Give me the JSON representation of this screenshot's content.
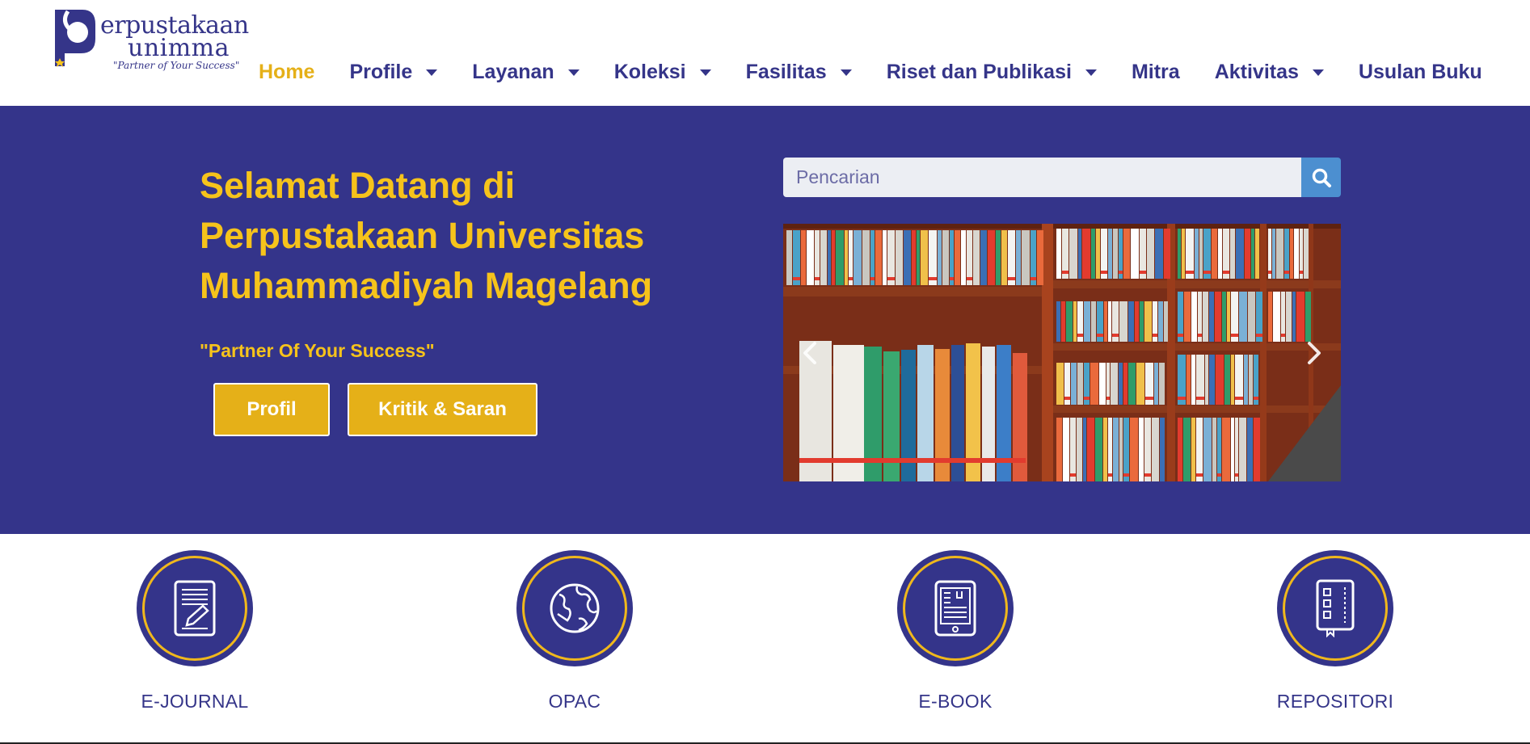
{
  "logo": {
    "word1": "erpustakaan",
    "word2": "unimma",
    "tagline": "\"Partner of Your Success\""
  },
  "nav": {
    "items": [
      {
        "label": "Home",
        "dropdown": false,
        "active": true
      },
      {
        "label": "Profile",
        "dropdown": true,
        "active": false
      },
      {
        "label": "Layanan",
        "dropdown": true,
        "active": false
      },
      {
        "label": "Koleksi",
        "dropdown": true,
        "active": false
      },
      {
        "label": "Fasilitas",
        "dropdown": true,
        "active": false
      },
      {
        "label": "Riset dan Publikasi",
        "dropdown": true,
        "active": false
      },
      {
        "label": "Mitra",
        "dropdown": false,
        "active": false
      },
      {
        "label": "Aktivitas",
        "dropdown": true,
        "active": false
      },
      {
        "label": "Usulan Buku",
        "dropdown": false,
        "active": false
      }
    ]
  },
  "hero": {
    "title": "Selamat Datang di Perpustakaan Universitas Muhammadiyah Magelang",
    "subtitle": "\"Partner Of Your Success\"",
    "profil_button": "Profil",
    "kritik_button": "Kritik & Saran"
  },
  "search": {
    "placeholder": "Pencarian"
  },
  "services": [
    {
      "label": "E-JOURNAL",
      "icon": "document-edit-icon"
    },
    {
      "label": "OPAC",
      "icon": "globe-icon"
    },
    {
      "label": "E-BOOK",
      "icon": "ebook-reader-icon"
    },
    {
      "label": "REPOSITORI",
      "icon": "repository-book-icon"
    }
  ],
  "colors": {
    "primary": "#34348a",
    "accent": "#f6c31b",
    "button": "#e5b018",
    "search_button": "#4c8fd0"
  }
}
